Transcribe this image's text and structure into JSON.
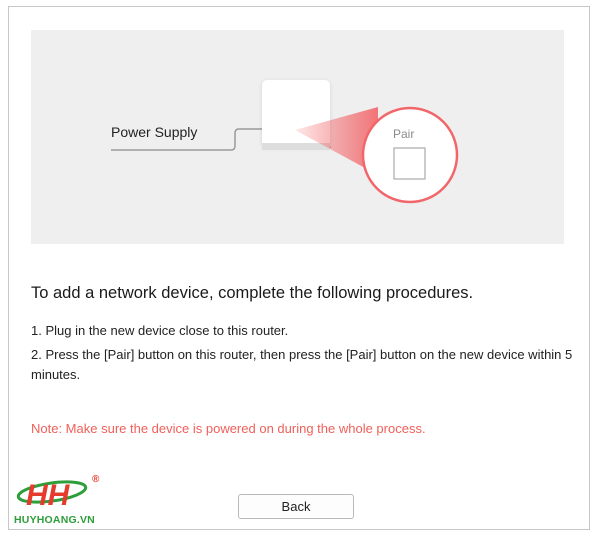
{
  "illustration": {
    "power_supply_label": "Power Supply",
    "pair_label": "Pair"
  },
  "content": {
    "heading": "To add a network device, complete the following procedures.",
    "step1": "1. Plug in the new device close to this router.",
    "step2": "2. Press the [Pair] button on this router, then press the [Pair] button on the new device within 5 minutes.",
    "note": "Note: Make sure the device is powered on during the whole process."
  },
  "footer": {
    "back_label": "Back"
  },
  "watermark": {
    "text": "HUYHOANG.VN",
    "registered_mark": "®"
  },
  "colors": {
    "note": "#f0605a",
    "accent_red": "#f2666a",
    "panel_bg": "#efefef",
    "logo_green": "#2e9e3a",
    "logo_red": "#e53a2c"
  }
}
